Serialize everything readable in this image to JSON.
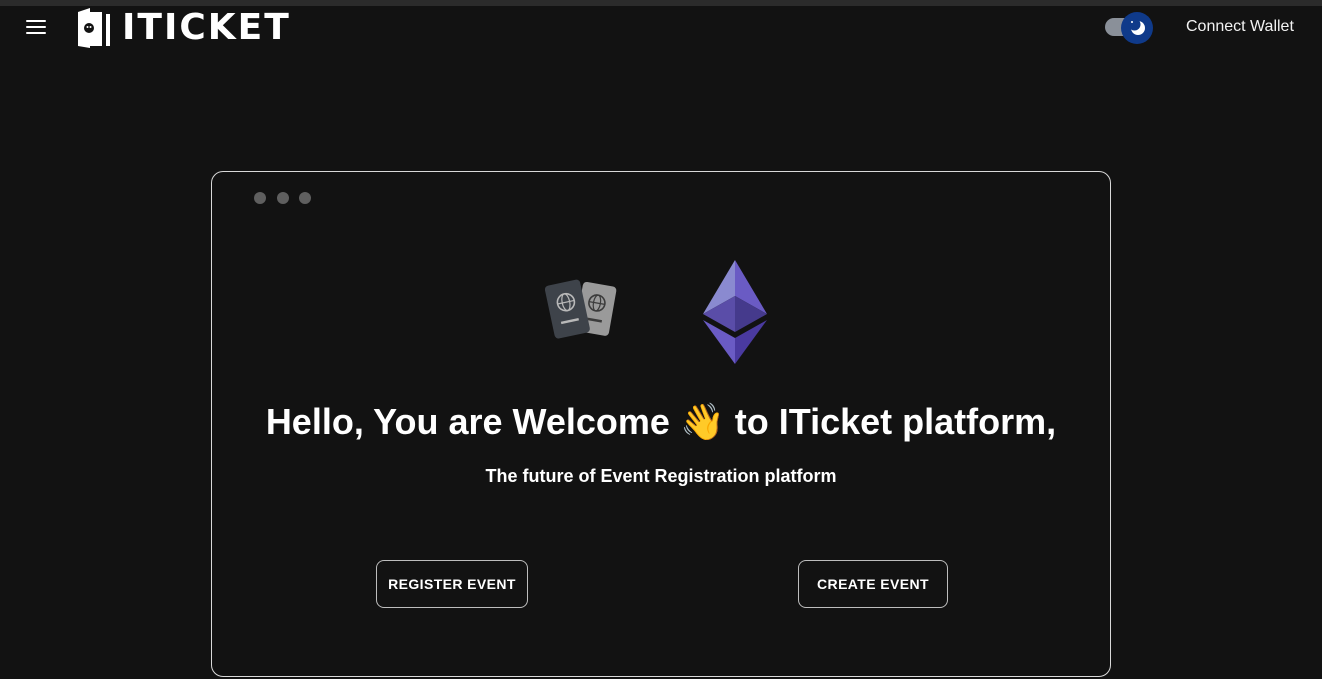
{
  "header": {
    "logo_text": "ITICKET",
    "menu_icon": "hamburger-menu-icon",
    "theme_toggle_icon": "moon-icon",
    "connect_wallet_label": "Connect Wallet"
  },
  "hero": {
    "window_dots": [
      "dot",
      "dot",
      "dot"
    ],
    "illustrations": [
      "passport-icon",
      "ethereum-icon"
    ],
    "title": "Hello, You are Welcome 👋 to ITicket platform,",
    "subtitle": "The future of Event Registration platform",
    "register_button_label": "REGISTER EVENT",
    "create_button_label": "CREATE EVENT"
  },
  "colors": {
    "background": "#121212",
    "card_border": "#d9d9d9",
    "toggle_thumb": "#0f3a8a",
    "ethereum_purple": "#6a5bc4"
  }
}
